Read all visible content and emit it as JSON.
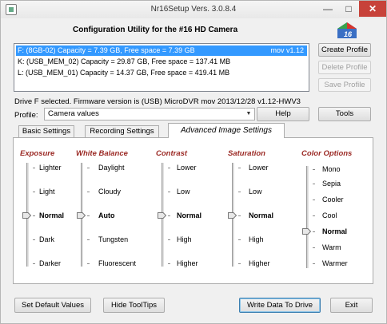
{
  "window": {
    "title": "Nr16Setup  Vers. 3.0.8.4",
    "minimize": "—",
    "maximize": "□",
    "close": "✕"
  },
  "header": {
    "title": "Configuration Utility for the #16 HD Camera",
    "logo_text": "16"
  },
  "drives": [
    {
      "label": "F: (8GB-02) Capacity = 7.39 GB, Free space = 7.39 GB",
      "extra": "mov v1.12"
    },
    {
      "label": "K: (USB_MEM_02) Capacity = 29.87 GB, Free space = 137.41 MB",
      "extra": ""
    },
    {
      "label": "L: (USB_MEM_01) Capacity = 14.37 GB, Free space = 419.41 MB",
      "extra": ""
    }
  ],
  "buttons": {
    "create_profile": "Create Profile",
    "delete_profile": "Delete Profile",
    "save_profile": "Save Profile",
    "help": "Help",
    "tools": "Tools",
    "set_defaults": "Set Default Values",
    "hide_tooltips": "Hide ToolTips",
    "write_data": "Write Data To Drive",
    "exit": "Exit"
  },
  "status": "Drive F selected. Firmware version is (USB) MicroDVR mov 2013/12/28 v1.12-HWV3",
  "profile": {
    "label": "Profile:",
    "value": "Camera values",
    "arrow": "▼"
  },
  "tabs": [
    "Basic Settings",
    "Recording Settings",
    "Advanced Image Settings"
  ],
  "columns": {
    "exposure": {
      "title": "Exposure",
      "options": [
        "Lighter",
        "Light",
        "Normal",
        "Dark",
        "Darker"
      ],
      "selected": "Normal"
    },
    "white_balance": {
      "title": "White Balance",
      "options": [
        "Daylight",
        "Cloudy",
        "Auto",
        "Tungsten",
        "Fluorescent"
      ],
      "selected": "Auto"
    },
    "contrast": {
      "title": "Contrast",
      "options": [
        "Lower",
        "Low",
        "Normal",
        "High",
        "Higher"
      ],
      "selected": "Normal"
    },
    "saturation": {
      "title": "Saturation",
      "options": [
        "Lower",
        "Low",
        "Normal",
        "High",
        "Higher"
      ],
      "selected": "Normal"
    },
    "color_options": {
      "title": "Color Options",
      "options": [
        "Mono",
        "Sepia",
        "Cooler",
        "Cool",
        "Normal",
        "Warm",
        "Warmer"
      ],
      "selected": "Normal"
    }
  },
  "colors": {
    "accent": "#3399ff",
    "heading": "#9b2a25",
    "close": "#c7423a"
  }
}
